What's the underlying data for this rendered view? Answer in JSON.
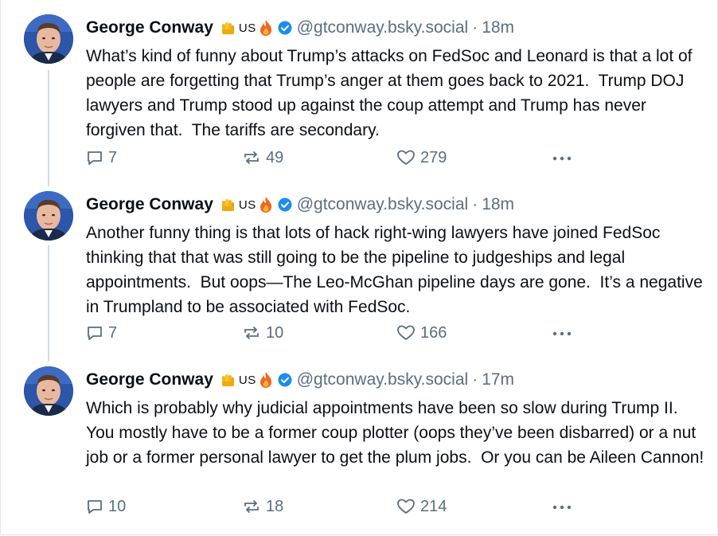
{
  "colors": {
    "text": "#0b0f14",
    "muted": "#5b6d80",
    "verified": "#1d8cf0",
    "thread_line": "#d4dbe2"
  },
  "posts": [
    {
      "author": "George Conway",
      "badge_hand_icon": "raised-fist-emoji",
      "badge_flag": "US",
      "badge_fire_icon": "fire-emoji",
      "verified_icon": "verified-checkmark-icon",
      "handle": "@gtconway.bsky.social",
      "separator": "·",
      "time": "18m",
      "text": "What’s kind of funny about Trump’s attacks on FedSoc and Leonard is that a lot of people are forgetting that Trump’s anger at them goes back to 2021.  Trump DOJ lawyers and Trump stood up against the coup attempt and Trump has never forgiven that.  The tariffs are secondary.",
      "replies": "7",
      "reposts": "49",
      "likes": "279"
    },
    {
      "author": "George Conway",
      "badge_hand_icon": "raised-fist-emoji",
      "badge_flag": "US",
      "badge_fire_icon": "fire-emoji",
      "verified_icon": "verified-checkmark-icon",
      "handle": "@gtconway.bsky.social",
      "separator": "·",
      "time": "18m",
      "text": "Another funny thing is that lots of hack right-wing lawyers have joined FedSoc thinking that that was still going to be the pipeline to judgeships and legal appointments.  But oops—The Leo-McGhan pipeline days are gone.  It’s a negative in Trumpland to be associated with FedSoc.",
      "replies": "7",
      "reposts": "10",
      "likes": "166"
    },
    {
      "author": "George Conway",
      "badge_hand_icon": "raised-fist-emoji",
      "badge_flag": "US",
      "badge_fire_icon": "fire-emoji",
      "verified_icon": "verified-checkmark-icon",
      "handle": "@gtconway.bsky.social",
      "separator": "·",
      "time": "17m",
      "text": "Which is probably why judicial appointments have been so slow during Trump II.  You mostly have to be a former coup plotter (oops they’ve been disbarred) or a nut job or a former personal lawyer to get the plum jobs.  Or you can be Aileen Cannon!",
      "replies": "10",
      "reposts": "18",
      "likes": "214"
    }
  ]
}
